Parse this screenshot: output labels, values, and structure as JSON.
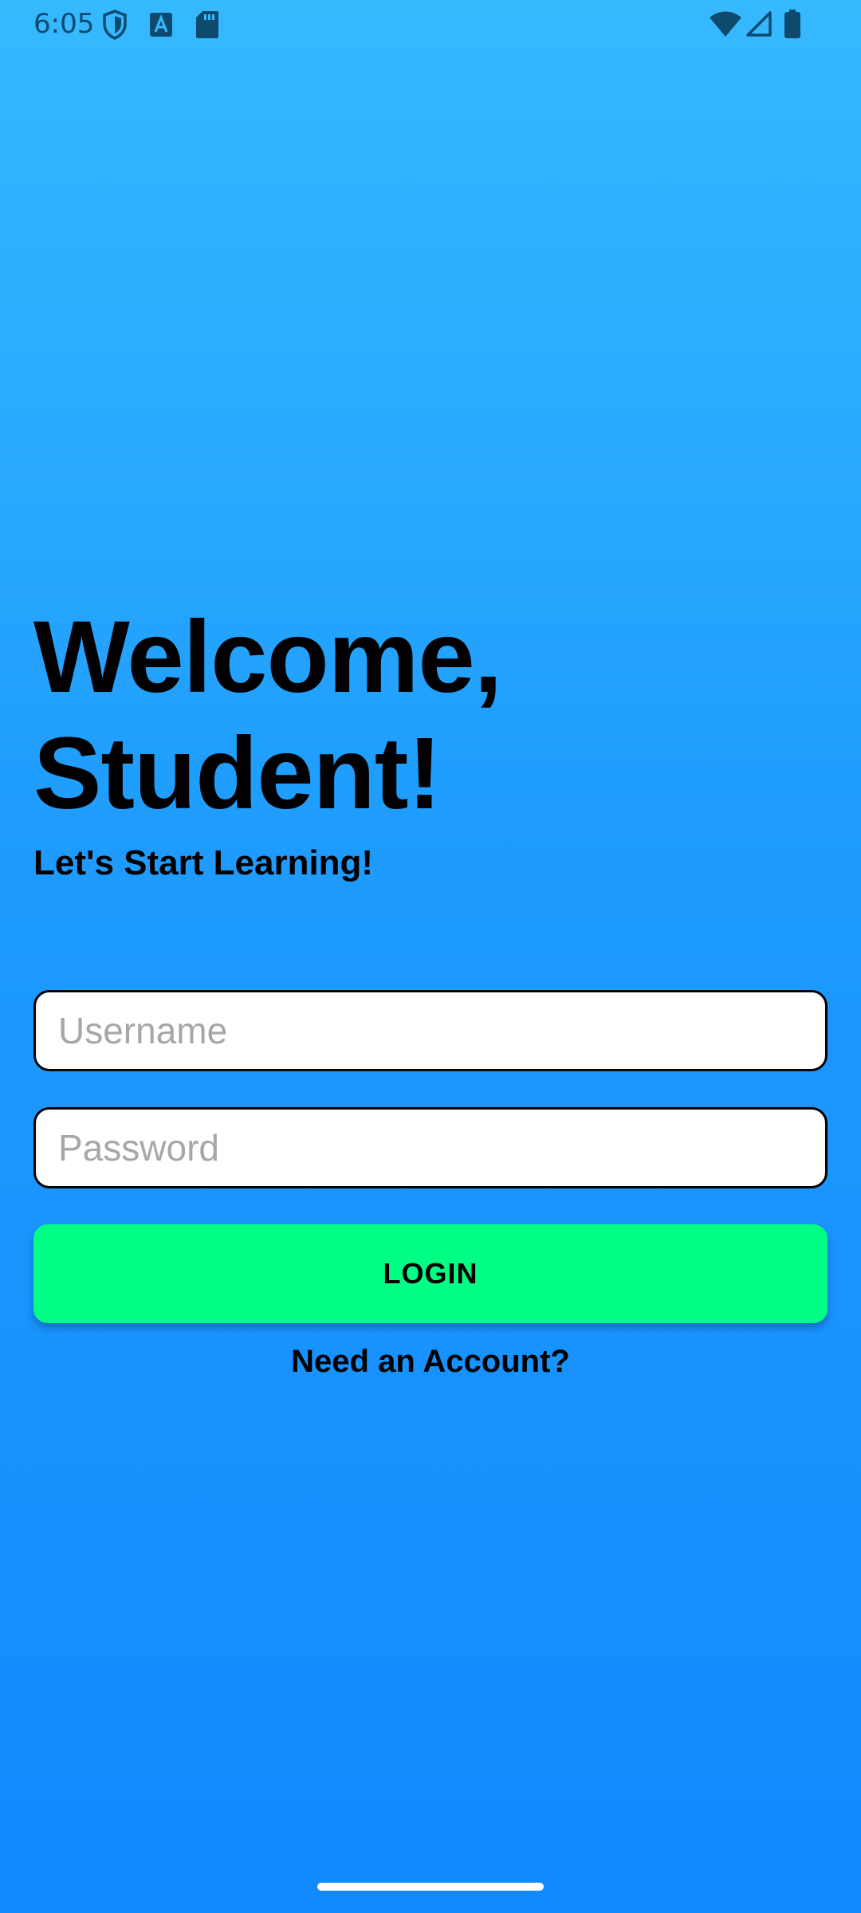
{
  "status_bar": {
    "time": "6:05",
    "icons": [
      "shield-icon",
      "font-icon",
      "sd-card-icon",
      "wifi-icon",
      "signal-icon",
      "battery-icon"
    ]
  },
  "welcome": {
    "title_line1": "Welcome,",
    "title_line2": "Student!",
    "subtitle": "Let's Start Learning!"
  },
  "form": {
    "username_placeholder": "Username",
    "username_value": "",
    "password_placeholder": "Password",
    "password_value": "",
    "login_label": "LOGIN",
    "account_link": "Need an Account?"
  },
  "colors": {
    "background_top": "#36b9ff",
    "background_bottom": "#1289fe",
    "login_button": "#00ff84"
  }
}
